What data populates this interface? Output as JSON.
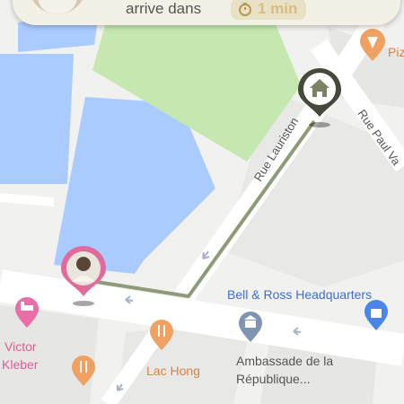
{
  "banner": {
    "text": "arrive dans",
    "eta": "1 min"
  },
  "pois": {
    "pizza": "Piz",
    "bell_ross": "Bell & Ross Headquarters",
    "victor_line1": "Victor",
    "victor_line2": "Kleber",
    "lac_hong": "Lac Hong",
    "ambassade_line1": "Ambassade de la",
    "ambassade_line2": "République..."
  },
  "streets": {
    "rue_lauriston": "Rue Lauriston",
    "rue_paul": "Rue Paul Va"
  },
  "colors": {
    "route": "#8f9a78",
    "water": "#aacbff",
    "park": "#c5e8b1",
    "user_pin": "#e26a9a",
    "home_pin": "#ffffff",
    "bell_ross_text": "#3d6fd0",
    "food_text": "#e0803c",
    "hotel_text": "#e05a98"
  },
  "icons": {
    "home": "home-icon",
    "food": "restaurant-icon",
    "hotel": "hotel-icon",
    "embassy": "government-icon",
    "shopping": "shopping-bag-icon",
    "timer": "timer-icon",
    "pizza": "pizza-icon"
  }
}
